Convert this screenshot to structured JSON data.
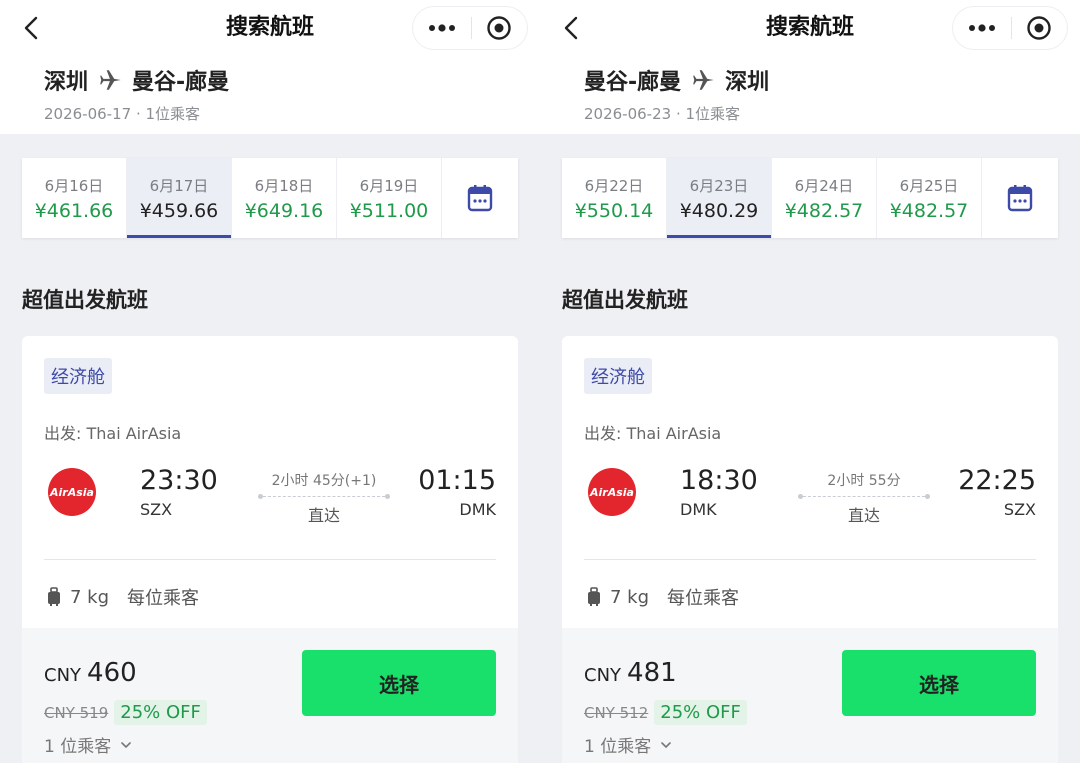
{
  "screens": [
    {
      "nav_title": "搜索航班",
      "route": {
        "from": "深圳",
        "to": "曼谷-廊曼"
      },
      "trip_meta": "2026-06-17 · 1位乘客",
      "dates": [
        {
          "date": "6月16日",
          "price": "¥461.66"
        },
        {
          "date": "6月17日",
          "price": "¥459.66"
        },
        {
          "date": "6月18日",
          "price": "¥649.16"
        },
        {
          "date": "6月19日",
          "price": "¥511.00"
        }
      ],
      "selected_date_index": 1,
      "section_title": "超值出发航班",
      "flight": {
        "cabin": "经济舱",
        "airline_line": "出发: Thai AirAsia",
        "airline_logo_text": "AirAsia",
        "dep_time": "23:30",
        "dep_code": "SZX",
        "duration": "2小时 45分(+1)",
        "stops": "直达",
        "arr_time": "01:15",
        "arr_code": "DMK",
        "baggage": "7 kg",
        "baggage_per": "每位乘客",
        "currency": "CNY",
        "price": "460",
        "old_price": "CNY 519",
        "discount": "25% OFF",
        "passengers": "1 位乘客",
        "select_label": "选择"
      }
    },
    {
      "nav_title": "搜索航班",
      "route": {
        "from": "曼谷-廊曼",
        "to": "深圳"
      },
      "trip_meta": "2026-06-23 · 1位乘客",
      "dates": [
        {
          "date": "6月22日",
          "price": "¥550.14"
        },
        {
          "date": "6月23日",
          "price": "¥480.29"
        },
        {
          "date": "6月24日",
          "price": "¥482.57"
        },
        {
          "date": "6月25日",
          "price": "¥482.57"
        }
      ],
      "selected_date_index": 1,
      "section_title": "超值出发航班",
      "flight": {
        "cabin": "经济舱",
        "airline_line": "出发: Thai AirAsia",
        "airline_logo_text": "AirAsia",
        "dep_time": "18:30",
        "dep_code": "DMK",
        "duration": "2小时 55分",
        "stops": "直达",
        "arr_time": "22:25",
        "arr_code": "SZX",
        "baggage": "7 kg",
        "baggage_per": "每位乘客",
        "currency": "CNY",
        "price": "481",
        "old_price": "CNY 512",
        "discount": "25% OFF",
        "passengers": "1 位乘客",
        "select_label": "选择"
      }
    }
  ],
  "colors": {
    "accent": "#3e4aa8",
    "price_green": "#1f9a4a",
    "select_button": "#18e06a",
    "airline_red": "#e3262d"
  },
  "icons": [
    "back-icon",
    "more-icon",
    "close-icon",
    "plane-icon",
    "calendar-icon",
    "luggage-icon",
    "chevron-down-icon"
  ]
}
